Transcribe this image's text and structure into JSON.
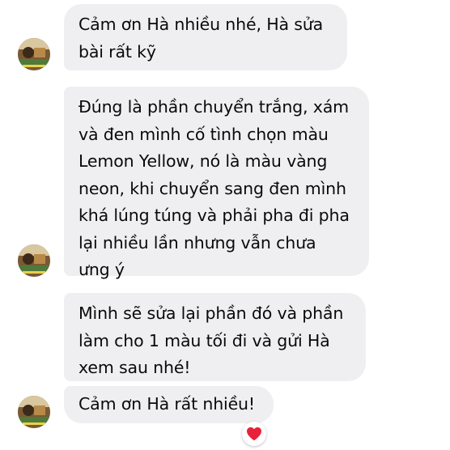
{
  "messages": [
    {
      "text": "Cảm ơn Hà nhiều nhé, Hà sửa\nbài rất kỹ"
    },
    {
      "text": "Đúng là phần chuyển trắng, xám\nvà đen mình cố tình chọn màu\nLemon Yellow, nó là màu vàng\nneon, khi chuyển sang đen mình\nkhá lúng túng và phải pha đi pha\nlại nhiều lần nhưng vẫn chưa\nưng ý"
    },
    {
      "text": "Mình sẽ sửa lại phần đó và phần\nlàm cho 1 màu tối đi và gửi Hà\nxem sau nhé!"
    },
    {
      "text": "Cảm ơn Hà rất nhiều!"
    }
  ],
  "reaction": {
    "icon": "heart-icon",
    "color": "#e8223a"
  },
  "colors": {
    "bubble": "#efeff1",
    "text": "#0a0a0a"
  }
}
